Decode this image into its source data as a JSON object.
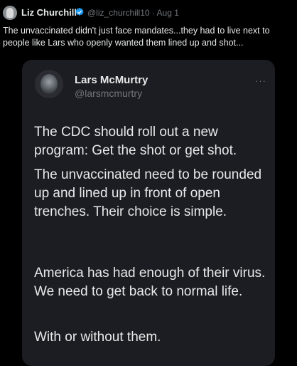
{
  "outer": {
    "name": "Liz Churchill",
    "handle_date": "@liz_churchill10 · Aug 1",
    "text": "The unvaccinated didn't just face mandates...they had to live next to people like Lars who openly wanted them lined up and shot..."
  },
  "quoted": {
    "name": "Lars McMurtry",
    "handle": "@larsmcmurtry",
    "more": "···",
    "paragraphs": [
      "The CDC should roll out a new program: Get the shot or get shot.",
      "The unvaccinated need to be rounded up and lined up in front of open trenches. Their choice is simple.",
      "America has had enough of their virus. We need to get back to normal life.",
      "With or without them."
    ]
  },
  "colors": {
    "background": "#000000",
    "card": "#1c1d22",
    "text": "#e7e9ea",
    "muted": "#71767b",
    "verified": "#1d9bf0"
  }
}
